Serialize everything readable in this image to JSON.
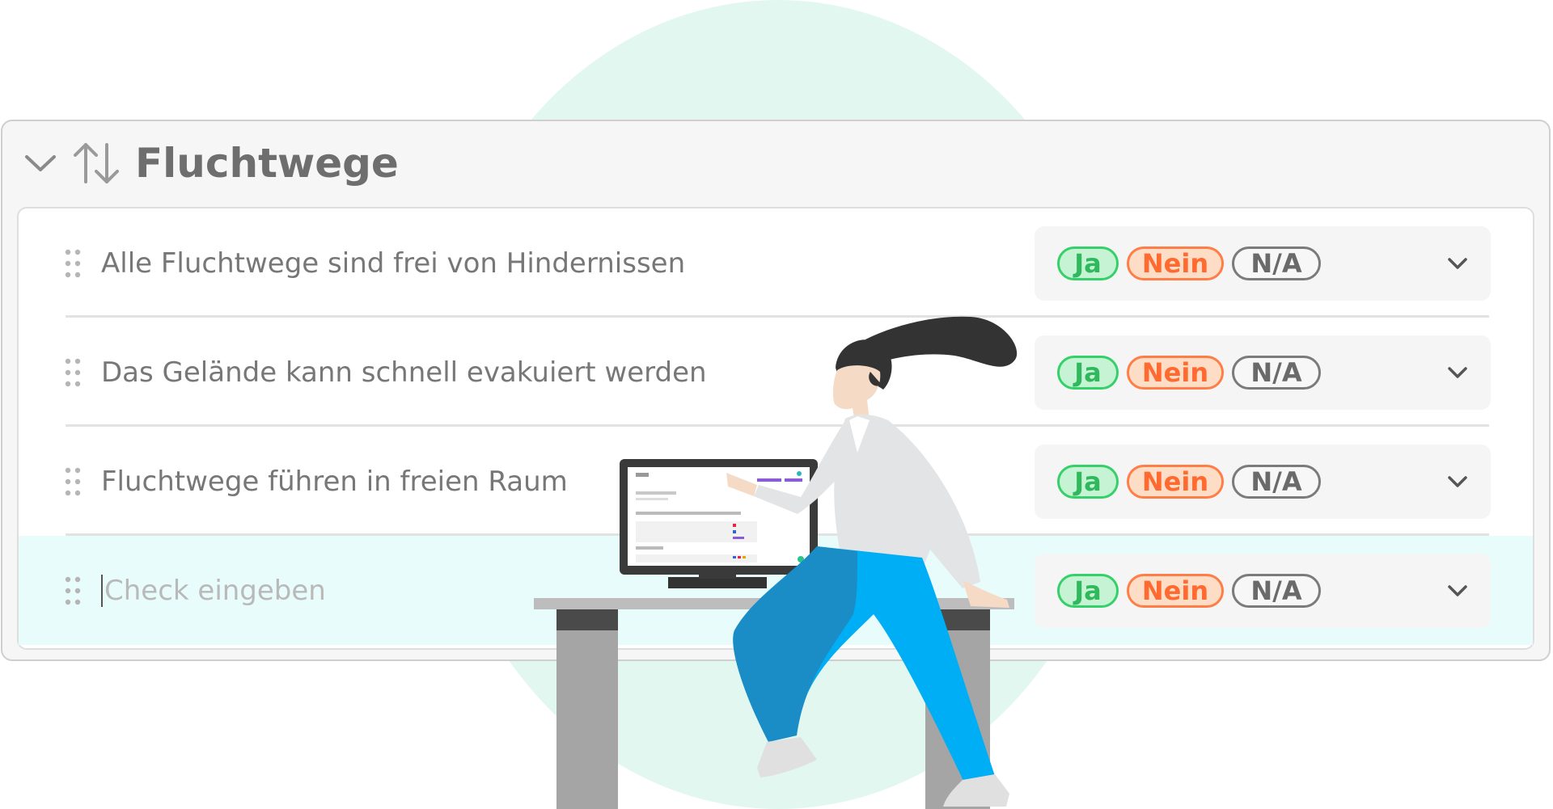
{
  "section": {
    "title": "Fluchtwege",
    "collapse_icon": "chevron-down-icon",
    "sort_icon": "sort-arrows-icon"
  },
  "checks": [
    {
      "label": "Alle Fluchtwege sind frei von Hindernissen"
    },
    {
      "label": "Das Gelände kann schnell evakuiert werden"
    },
    {
      "label": "Fluchtwege führen in freien Raum"
    }
  ],
  "new_check": {
    "placeholder": "Check eingeben"
  },
  "answers": {
    "yes": "Ja",
    "no": "Nein",
    "na": "N/A"
  },
  "colors": {
    "yes": "#36d06a",
    "no": "#ff7d46",
    "na": "#7b7b7b",
    "active_row": "#e8fcfb",
    "background_circle": "#e3f7f1",
    "pants": "#00aef5"
  }
}
